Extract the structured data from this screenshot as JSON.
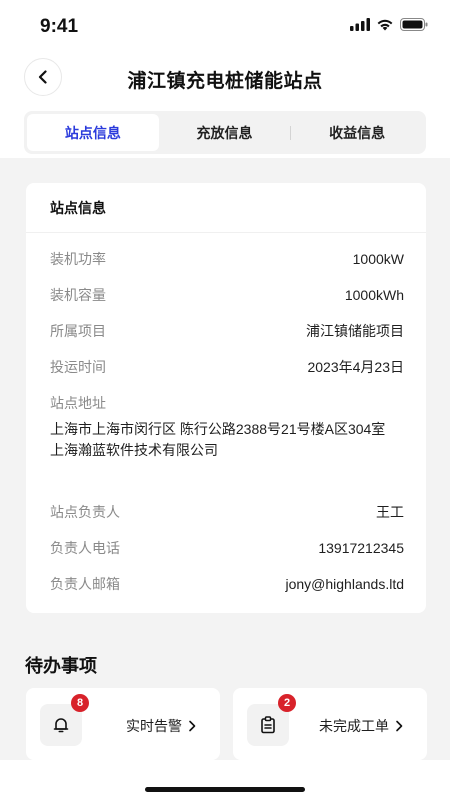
{
  "status_bar": {
    "time": "9:41"
  },
  "nav": {
    "title": "浦江镇充电桩储能站点"
  },
  "tabs": [
    {
      "label": "站点信息",
      "active": true
    },
    {
      "label": "充放信息",
      "active": false
    },
    {
      "label": "收益信息",
      "active": false
    }
  ],
  "card": {
    "title": "站点信息",
    "fields": [
      {
        "label": "装机功率",
        "value": "1000kW"
      },
      {
        "label": "装机容量",
        "value": "1000kWh"
      },
      {
        "label": "所属项目",
        "value": "浦江镇储能项目"
      },
      {
        "label": "投运时间",
        "value": "2023年4月23日"
      }
    ],
    "address": {
      "label": "站点地址",
      "line1": "上海市上海市闵行区 陈行公路2388号21号楼A区304室",
      "line2": "上海瀚蓝软件技术有限公司"
    },
    "contacts": [
      {
        "label": "站点负责人",
        "value": "王工"
      },
      {
        "label": "负责人电话",
        "value": "13917212345"
      },
      {
        "label": "负责人邮箱",
        "value": "jony@highlands.ltd"
      }
    ]
  },
  "todo": {
    "title": "待办事项",
    "items": [
      {
        "label": "实时告警",
        "badge": "8",
        "icon": "bell-icon"
      },
      {
        "label": "未完成工单",
        "badge": "2",
        "icon": "clipboard-icon"
      }
    ]
  },
  "colors": {
    "accent": "#2b3bdc",
    "badge": "#d8222a",
    "background": "#f3f3f3"
  }
}
